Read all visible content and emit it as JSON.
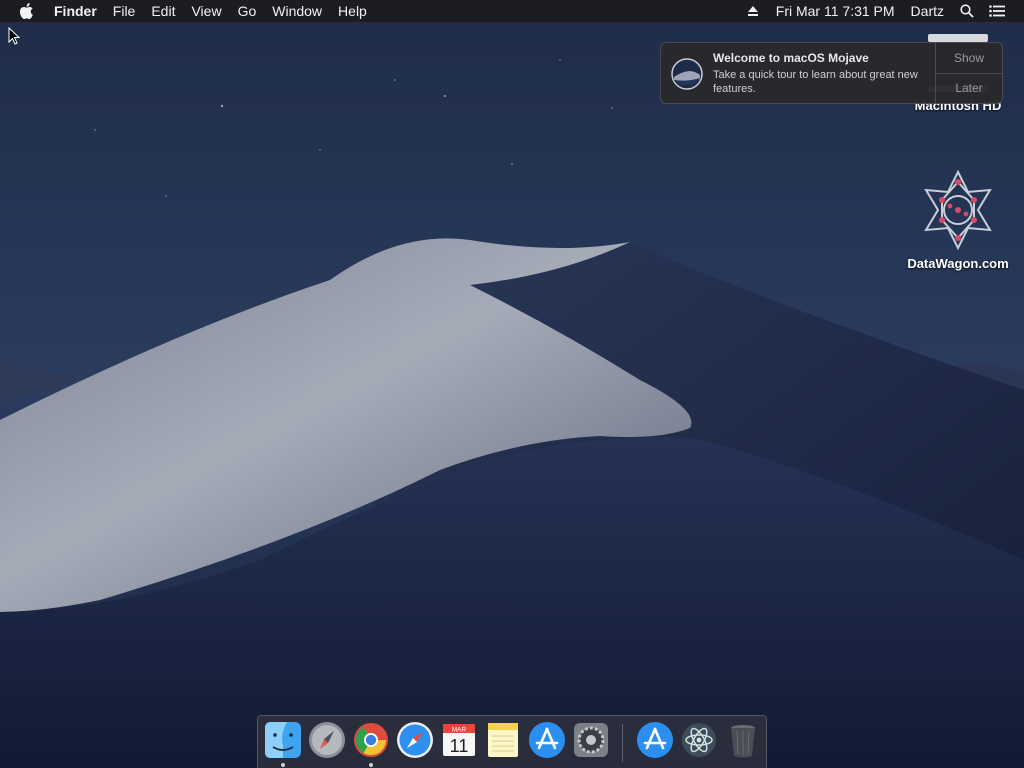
{
  "menubar": {
    "app_name": "Finder",
    "menus": [
      "File",
      "Edit",
      "View",
      "Go",
      "Window",
      "Help"
    ],
    "clock": "Fri Mar 11  7:31 PM",
    "user": "Dartz",
    "icons": [
      "apple-icon",
      "eject-icon",
      "spotlight-search-icon",
      "notification-center-icon"
    ]
  },
  "notification": {
    "title": "Welcome to macOS Mojave",
    "body": "Take a quick tour to learn about great new features.",
    "show_label": "Show",
    "later_label": "Later"
  },
  "desktop_icons": [
    {
      "label": "Macintosh HD",
      "icon": "hard-drive-icon"
    },
    {
      "label": "DataWagon.com",
      "icon": "datawagon-logo-icon"
    }
  ],
  "dock": {
    "items": [
      "finder-icon",
      "launchpad-icon",
      "chrome-icon",
      "safari-icon",
      "calendar-icon",
      "notes-icon",
      "app-store-icon",
      "system-preferences-icon",
      "app-store-downloads-icon",
      "atom-icon",
      "trash-icon"
    ],
    "calendar_month": "MAR",
    "calendar_day": "11"
  },
  "colors": {
    "menubar_bg": "#1c1c20",
    "sky": "#1a2440",
    "dune_light": "#a6abb8"
  }
}
